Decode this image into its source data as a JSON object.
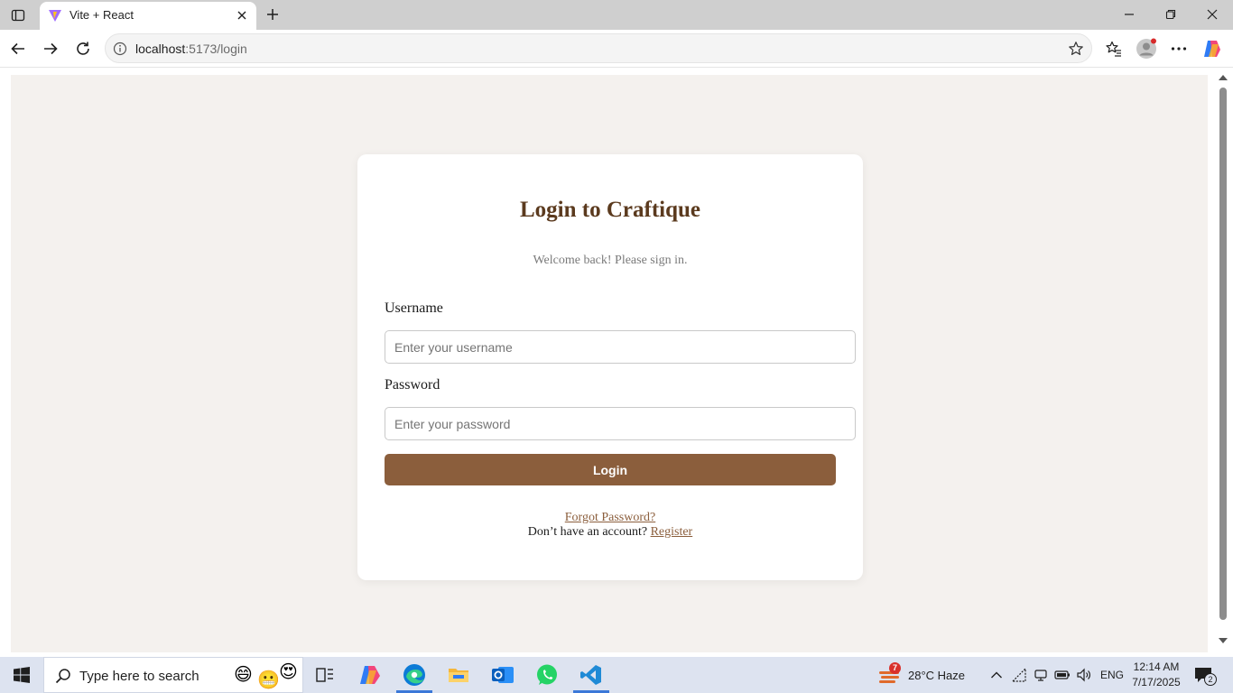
{
  "browser": {
    "tab_title": "Vite + React",
    "url_host": "localhost",
    "url_rest": ":5173/login"
  },
  "login": {
    "title": "Login to Craftique",
    "subtitle": "Welcome back! Please sign in.",
    "username_label": "Username",
    "username_placeholder": "Enter your username",
    "password_label": "Password",
    "password_placeholder": "Enter your password",
    "submit_label": "Login",
    "forgot_link": "Forgot Password?",
    "register_prompt": "Don’t have an account?",
    "register_link": "Register"
  },
  "taskbar": {
    "search_placeholder": "Type here to search",
    "weather_badge": "7",
    "weather": "28°C  Haze",
    "language": "ENG",
    "time": "12:14 AM",
    "date": "7/17/2025",
    "notifications": "2"
  },
  "colors": {
    "brand_brown": "#8b5e3c",
    "title_brown": "#5b3a1e",
    "page_bg": "#f4f1ee"
  }
}
